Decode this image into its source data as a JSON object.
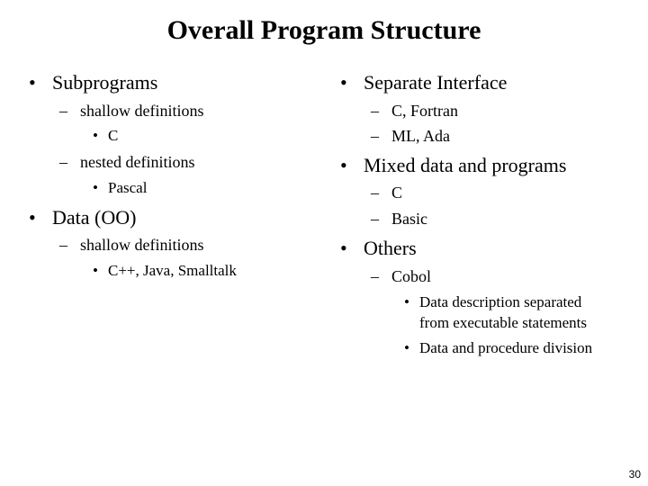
{
  "slide": {
    "title": "Overall Program Structure",
    "page_number": "30",
    "left_column": [
      {
        "level": 1,
        "marker": "•",
        "text": "Subprograms"
      },
      {
        "level": 2,
        "marker": "–",
        "text": "shallow definitions"
      },
      {
        "level": 3,
        "marker": "•",
        "text": "C"
      },
      {
        "level": 2,
        "marker": "–",
        "text": "nested definitions"
      },
      {
        "level": 3,
        "marker": "•",
        "text": "Pascal"
      },
      {
        "level": 1,
        "marker": "•",
        "text": "Data (OO)"
      },
      {
        "level": 2,
        "marker": "–",
        "text": "shallow definitions"
      },
      {
        "level": 3,
        "marker": "•",
        "text": "C++, Java, Smalltalk"
      }
    ],
    "right_column": [
      {
        "level": 1,
        "marker": "•",
        "text": "Separate Interface"
      },
      {
        "level": 2,
        "marker": "–",
        "text": "C, Fortran"
      },
      {
        "level": 2,
        "marker": "–",
        "text": "ML, Ada"
      },
      {
        "level": 1,
        "marker": "•",
        "text": "Mixed data and programs"
      },
      {
        "level": 2,
        "marker": "–",
        "text": "C"
      },
      {
        "level": 2,
        "marker": "–",
        "text": "Basic"
      },
      {
        "level": 1,
        "marker": "•",
        "text": "Others"
      },
      {
        "level": 2,
        "marker": "–",
        "text": "Cobol"
      },
      {
        "level": 3,
        "marker": "•",
        "text": "Data description separated"
      },
      {
        "level": 3,
        "marker": "",
        "text": "from executable statements"
      },
      {
        "level": 3,
        "marker": "•",
        "text": "Data and procedure division"
      }
    ]
  }
}
